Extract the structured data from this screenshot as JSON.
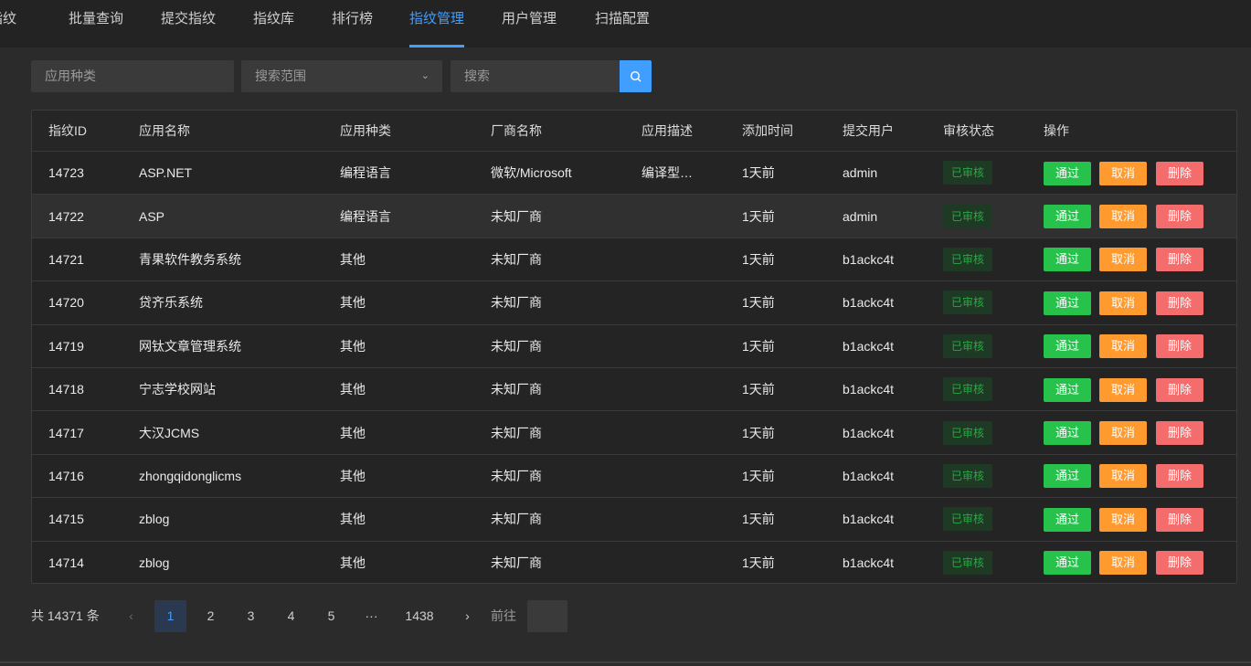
{
  "nav": {
    "items": [
      {
        "label": "指纹"
      },
      {
        "label": "批量查询"
      },
      {
        "label": "提交指纹"
      },
      {
        "label": "指纹库"
      },
      {
        "label": "排行榜"
      },
      {
        "label": "指纹管理",
        "active": true
      },
      {
        "label": "用户管理"
      },
      {
        "label": "扫描配置"
      }
    ]
  },
  "filters": {
    "category_placeholder": "应用种类",
    "scope_placeholder": "搜索范围",
    "search_placeholder": "搜索"
  },
  "table": {
    "headers": [
      "指纹ID",
      "应用名称",
      "应用种类",
      "厂商名称",
      "应用描述",
      "添加时间",
      "提交用户",
      "审核状态",
      "操作"
    ],
    "rows": [
      {
        "id": "14723",
        "name": "ASP.NET",
        "category": "编程语言",
        "vendor": "微软/Microsoft",
        "desc": "编译型…",
        "time": "1天前",
        "user": "admin",
        "status": "已审核"
      },
      {
        "id": "14722",
        "name": "ASP",
        "category": "编程语言",
        "vendor": "未知厂商",
        "desc": "",
        "time": "1天前",
        "user": "admin",
        "status": "已审核"
      },
      {
        "id": "14721",
        "name": "青果软件教务系统",
        "category": "其他",
        "vendor": "未知厂商",
        "desc": "",
        "time": "1天前",
        "user": "b1ackc4t",
        "status": "已审核"
      },
      {
        "id": "14720",
        "name": "贷齐乐系统",
        "category": "其他",
        "vendor": "未知厂商",
        "desc": "",
        "time": "1天前",
        "user": "b1ackc4t",
        "status": "已审核"
      },
      {
        "id": "14719",
        "name": "网钛文章管理系统",
        "category": "其他",
        "vendor": "未知厂商",
        "desc": "",
        "time": "1天前",
        "user": "b1ackc4t",
        "status": "已审核"
      },
      {
        "id": "14718",
        "name": "宁志学校网站",
        "category": "其他",
        "vendor": "未知厂商",
        "desc": "",
        "time": "1天前",
        "user": "b1ackc4t",
        "status": "已审核"
      },
      {
        "id": "14717",
        "name": "大汉JCMS",
        "category": "其他",
        "vendor": "未知厂商",
        "desc": "",
        "time": "1天前",
        "user": "b1ackc4t",
        "status": "已审核"
      },
      {
        "id": "14716",
        "name": "zhongqidonglicms",
        "category": "其他",
        "vendor": "未知厂商",
        "desc": "",
        "time": "1天前",
        "user": "b1ackc4t",
        "status": "已审核"
      },
      {
        "id": "14715",
        "name": "zblog",
        "category": "其他",
        "vendor": "未知厂商",
        "desc": "",
        "time": "1天前",
        "user": "b1ackc4t",
        "status": "已审核"
      },
      {
        "id": "14714",
        "name": "zblog",
        "category": "其他",
        "vendor": "未知厂商",
        "desc": "",
        "time": "1天前",
        "user": "b1ackc4t",
        "status": "已审核"
      }
    ],
    "actions": {
      "pass": "通过",
      "cancel": "取消",
      "delete": "删除"
    }
  },
  "pagination": {
    "total": "共 14371 条",
    "pages": [
      "1",
      "2",
      "3",
      "4",
      "5"
    ],
    "ellipsis": "···",
    "last": "1438",
    "current": "1",
    "goto_label": "前往",
    "goto_value": ""
  },
  "colors": {
    "accent": "#409eff",
    "pass": "#27c24c",
    "cancel": "#ff9a2e",
    "delete": "#f56c6c"
  }
}
